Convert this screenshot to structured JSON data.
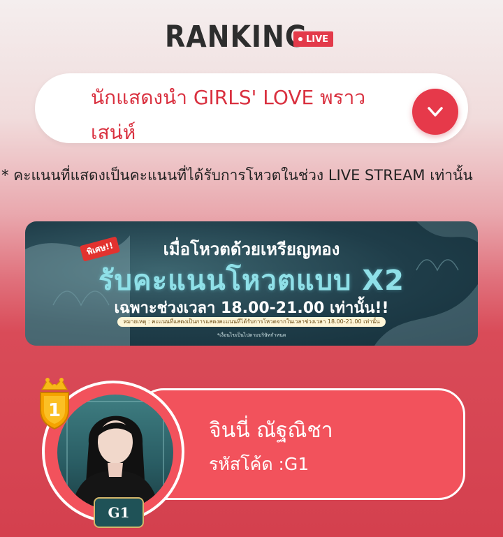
{
  "header": {
    "title": "RANKING",
    "live_label": "LIVE"
  },
  "category": {
    "selected": "นักแสดงนำ GIRLS' LOVE พราวเสน่ห์"
  },
  "note": "* คะแนนที่แสดงเป็นคะแนนที่ได้รับการโหวตในช่วง LIVE STREAM เท่านั้น",
  "banner": {
    "tag": "พิเศษ!!",
    "line1": "เมื่อโหวตด้วยเหรียญทอง",
    "line2": "รับคะแนนโหวตแบบ X2",
    "line3": "เฉพาะช่วงเวลา 18.00-21.00 เท่านั้น!!",
    "remark": "หมายเหตุ : คะแนนที่แสดงเป็นการแสดงคะแนนที่ได้รับการโหวตจากในเวลาช่วงเวลา 18.00-21.00 เท่านั้น",
    "small": "*เงื่อนไขเป็นไปตามบริษัทกำหนด"
  },
  "ranking": [
    {
      "rank": "1",
      "name": "จินนี่ ณัฐณิชา",
      "code_label": "รหัสโค้ด :G1",
      "badge": "G1"
    }
  ],
  "colors": {
    "accent": "#e6394a",
    "card": "#f2525c",
    "select_text": "#d9303f"
  }
}
